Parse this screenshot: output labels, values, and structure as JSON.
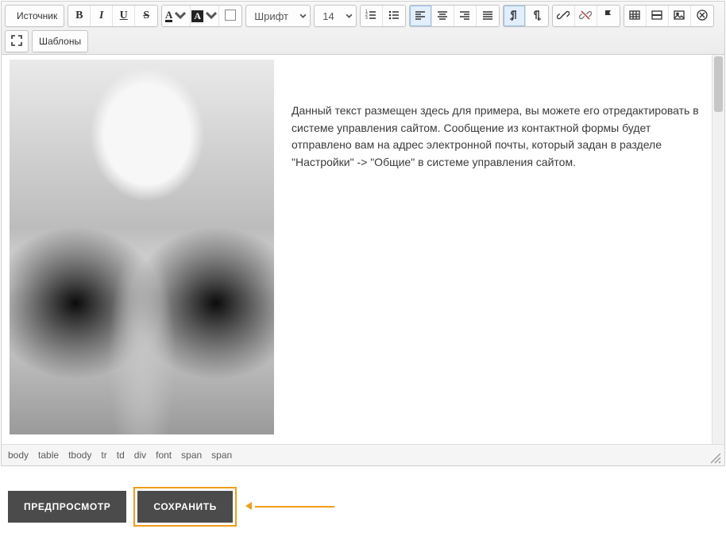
{
  "toolbar": {
    "source_label": "Источник",
    "font_dropdown": "Шрифт",
    "size_dropdown": "14",
    "templates_label": "Шаблоны"
  },
  "document": {
    "body_text": "Данный текст размещен здесь для примера, вы можете его отредактировать в системе управления сайтом. Сообщение из контактной формы будет отправлено вам на адрес электронной почты, который задан в разделе \"Настройки\" -> \"Общие\" в системе управления сайтом."
  },
  "path": [
    "body",
    "table",
    "tbody",
    "tr",
    "td",
    "div",
    "font",
    "span",
    "span"
  ],
  "actions": {
    "preview": "ПРЕДПРОСМОТР",
    "save": "СОХРАНИТЬ"
  },
  "colors": {
    "accent": "#f59b1a"
  }
}
